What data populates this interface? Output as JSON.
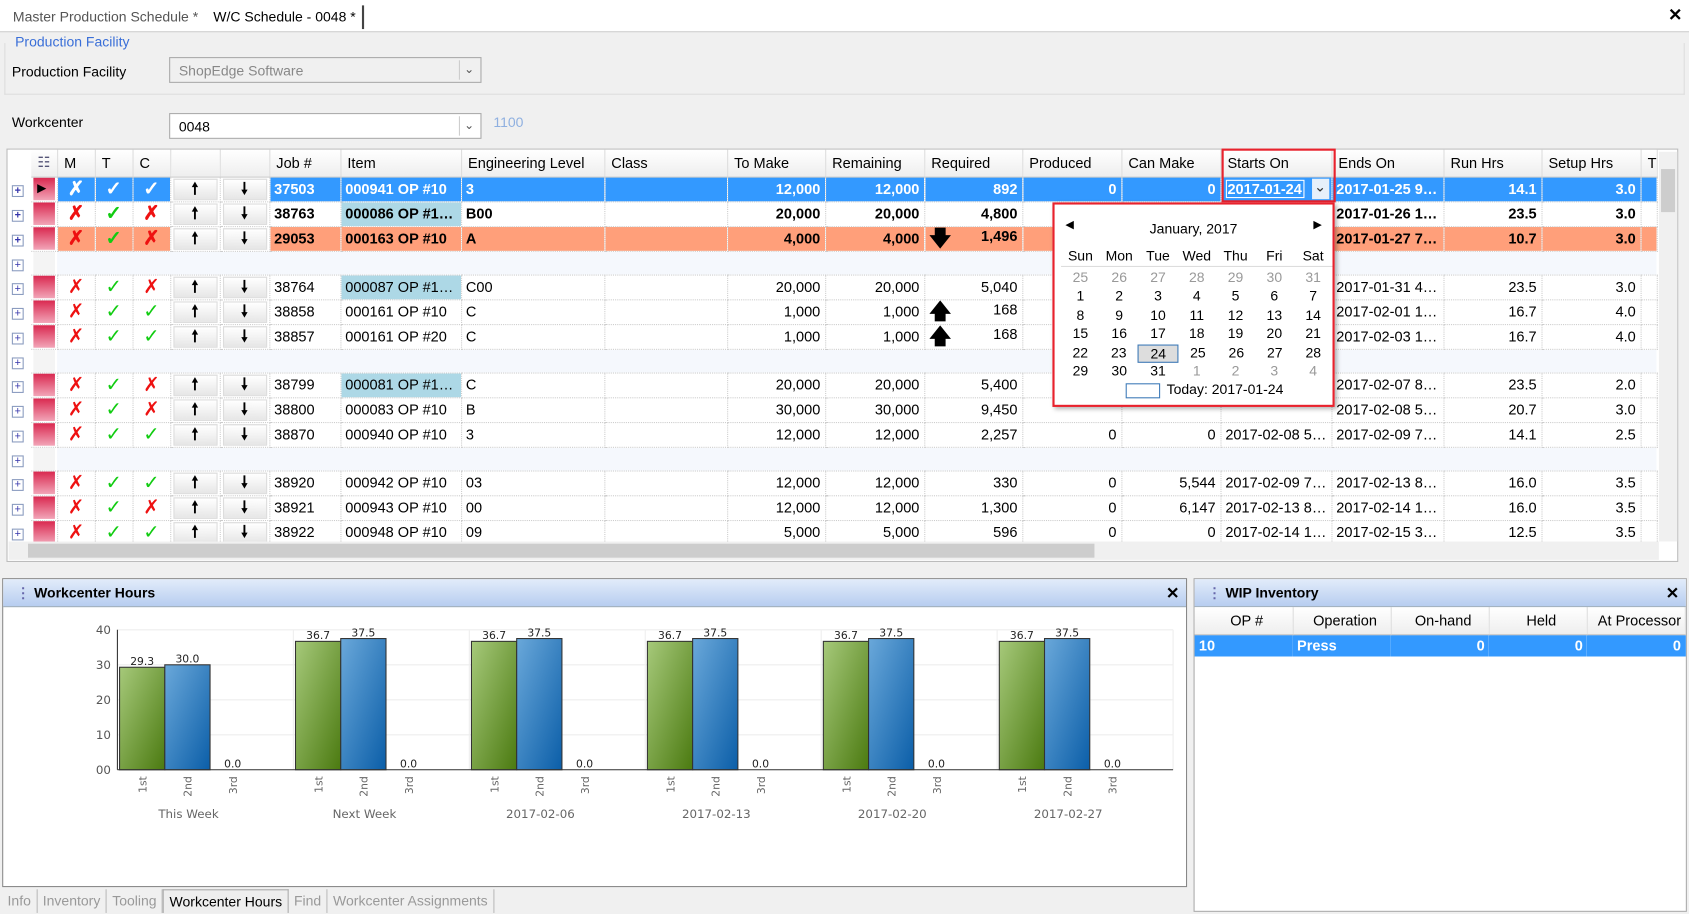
{
  "window": {
    "tabs": [
      {
        "label": "Master Production Schedule *",
        "active": false
      },
      {
        "label": "W/C Schedule - 0048 *",
        "active": true
      }
    ],
    "close_icon": "close-icon"
  },
  "filters": {
    "group_label": "Production Facility",
    "facility_label": "Production Facility",
    "facility_value": "ShopEdge Software",
    "workcenter_label": "Workcenter",
    "workcenter_value": "0048",
    "workcenter_code": "1100"
  },
  "grid": {
    "columns": [
      "M",
      "T",
      "C",
      "",
      "",
      "Job #",
      "Item",
      "Engineering Level",
      "Class",
      "To Make",
      "Remaining",
      "Required",
      "Produced",
      "Can Make",
      "Starts On",
      "Ends On",
      "Run Hrs",
      "Setup Hrs",
      "T"
    ],
    "rows": [
      {
        "style": "sel",
        "m": false,
        "t": true,
        "c": true,
        "job": "37503",
        "item": "000941 OP #10",
        "item_hl": false,
        "eng": "3",
        "class": "",
        "to_make": "12,000",
        "remaining": "12,000",
        "req_arrow": "",
        "required": "892",
        "produced": "0",
        "can_make": "0",
        "starts": "2017-01-24",
        "ends": "2017-01-25 9:...",
        "run": "14.1",
        "setup": "3.0"
      },
      {
        "style": "bold",
        "m": false,
        "t": true,
        "c": false,
        "job": "38763",
        "item": "000086 OP #10...",
        "item_hl": true,
        "eng": "B00",
        "class": "",
        "to_make": "20,000",
        "remaining": "20,000",
        "req_arrow": "",
        "required": "4,800",
        "produced": "",
        "can_make": "",
        "starts": "",
        "ends": "2017-01-26 10...",
        "run": "23.5",
        "setup": "3.0"
      },
      {
        "style": "orange",
        "m": false,
        "t": true,
        "c": false,
        "job": "29053",
        "item": "000163 OP #10",
        "item_hl": false,
        "eng": "A",
        "class": "",
        "to_make": "4,000",
        "remaining": "4,000",
        "req_arrow": "down",
        "required": "1,496",
        "produced": "",
        "can_make": "",
        "starts": "",
        "ends": "2017-01-27 7:...",
        "run": "10.7",
        "setup": "3.0"
      },
      {
        "style": "blank"
      },
      {
        "style": "",
        "m": false,
        "t": true,
        "c": false,
        "job": "38764",
        "item": "000087 OP #10...",
        "item_hl": true,
        "eng": "C00",
        "class": "",
        "to_make": "20,000",
        "remaining": "20,000",
        "req_arrow": "",
        "required": "5,040",
        "produced": "",
        "can_make": "",
        "starts": "",
        "ends": "2017-01-31 4:0...",
        "run": "23.5",
        "setup": "3.0"
      },
      {
        "style": "",
        "m": false,
        "t": true,
        "c": true,
        "job": "38858",
        "item": "000161 OP #10",
        "item_hl": false,
        "eng": "C",
        "class": "",
        "to_make": "1,000",
        "remaining": "1,000",
        "req_arrow": "up",
        "required": "168",
        "produced": "",
        "can_make": "",
        "starts": "",
        "ends": "2017-02-01 10:...",
        "run": "16.7",
        "setup": "4.0"
      },
      {
        "style": "",
        "m": false,
        "t": true,
        "c": true,
        "job": "38857",
        "item": "000161 OP #20",
        "item_hl": false,
        "eng": "C",
        "class": "",
        "to_make": "1,000",
        "remaining": "1,000",
        "req_arrow": "up",
        "required": "168",
        "produced": "",
        "can_make": "",
        "starts": "",
        "ends": "2017-02-03 12:...",
        "run": "16.7",
        "setup": "4.0"
      },
      {
        "style": "blank"
      },
      {
        "style": "",
        "m": false,
        "t": true,
        "c": false,
        "job": "38799",
        "item": "000081 OP #10...",
        "item_hl": true,
        "eng": "C",
        "class": "",
        "to_make": "20,000",
        "remaining": "20,000",
        "req_arrow": "",
        "required": "5,400",
        "produced": "",
        "can_make": "",
        "starts": "",
        "ends": "2017-02-07 8:0...",
        "run": "23.5",
        "setup": "2.0"
      },
      {
        "style": "",
        "m": false,
        "t": true,
        "c": false,
        "job": "38800",
        "item": "000083 OP #10",
        "item_hl": false,
        "eng": "B",
        "class": "",
        "to_make": "30,000",
        "remaining": "30,000",
        "req_arrow": "",
        "required": "9,450",
        "produced": "",
        "can_make": "",
        "starts": "",
        "ends": "2017-02-08 5:3...",
        "run": "20.7",
        "setup": "3.0"
      },
      {
        "style": "",
        "m": false,
        "t": true,
        "c": true,
        "job": "38870",
        "item": "000940 OP #10",
        "item_hl": false,
        "eng": "3",
        "class": "",
        "to_make": "12,000",
        "remaining": "12,000",
        "req_arrow": "",
        "required": "2,257",
        "produced": "0",
        "can_make": "0",
        "starts": "2017-02-08 5:3...",
        "ends": "2017-02-09 7:4...",
        "run": "14.1",
        "setup": "2.5"
      },
      {
        "style": "blank"
      },
      {
        "style": "",
        "m": false,
        "t": true,
        "c": true,
        "job": "38920",
        "item": "000942 OP #10",
        "item_hl": false,
        "eng": "03",
        "class": "",
        "to_make": "12,000",
        "remaining": "12,000",
        "req_arrow": "",
        "required": "330",
        "produced": "0",
        "can_make": "5,544",
        "starts": "2017-02-09 7:4...",
        "ends": "2017-02-13 8:3...",
        "run": "16.0",
        "setup": "3.5"
      },
      {
        "style": "",
        "m": false,
        "t": true,
        "c": false,
        "job": "38921",
        "item": "000943 OP #10",
        "item_hl": false,
        "eng": "00",
        "class": "",
        "to_make": "12,000",
        "remaining": "12,000",
        "req_arrow": "",
        "required": "1,300",
        "produced": "0",
        "can_make": "6,147",
        "starts": "2017-02-13 8:3...",
        "ends": "2017-02-14 1:5...",
        "run": "16.0",
        "setup": "3.5"
      },
      {
        "style": "",
        "m": false,
        "t": true,
        "c": true,
        "job": "38922",
        "item": "000948 OP #10",
        "item_hl": false,
        "eng": "09",
        "class": "",
        "to_make": "5,000",
        "remaining": "5,000",
        "req_arrow": "",
        "required": "596",
        "produced": "0",
        "can_make": "0",
        "starts": "2017-02-14 1:5...",
        "ends": "2017-02-15 3:0...",
        "run": "12.5",
        "setup": "3.5"
      }
    ]
  },
  "calendar": {
    "title": "January, 2017",
    "weekdays": [
      "Sun",
      "Mon",
      "Tue",
      "Wed",
      "Thu",
      "Fri",
      "Sat"
    ],
    "weeks": [
      [
        25,
        26,
        27,
        28,
        29,
        30,
        31
      ],
      [
        1,
        2,
        3,
        4,
        5,
        6,
        7
      ],
      [
        8,
        9,
        10,
        11,
        12,
        13,
        14
      ],
      [
        15,
        16,
        17,
        18,
        19,
        20,
        21
      ],
      [
        22,
        23,
        24,
        25,
        26,
        27,
        28
      ],
      [
        29,
        30,
        31,
        1,
        2,
        3,
        4
      ]
    ],
    "selected": 24,
    "today_label": "Today: 2017-01-24"
  },
  "workcenter_hours": {
    "title": "Workcenter Hours"
  },
  "chart_data": {
    "type": "bar",
    "ylim": [
      0,
      40
    ],
    "yticks": [
      "00",
      "10",
      "20",
      "30",
      "40"
    ],
    "groups": [
      "This Week",
      "Next Week",
      "2017-02-06",
      "2017-02-13",
      "2017-02-20",
      "2017-02-27"
    ],
    "categories": [
      "1st",
      "2nd",
      "3rd"
    ],
    "values": [
      [
        29.3,
        30.0,
        0.0
      ],
      [
        36.7,
        37.5,
        0.0
      ],
      [
        36.7,
        37.5,
        0.0
      ],
      [
        36.7,
        37.5,
        0.0
      ],
      [
        36.7,
        37.5,
        0.0
      ],
      [
        36.7,
        37.5,
        0.0
      ]
    ],
    "colors": [
      "#6a9a2a",
      "#2a78b8"
    ],
    "grid": true
  },
  "bottom_tabs": [
    {
      "label": "Info",
      "active": false
    },
    {
      "label": "Inventory",
      "active": false
    },
    {
      "label": "Tooling",
      "active": false
    },
    {
      "label": "Workcenter Hours",
      "active": true
    },
    {
      "label": "Find",
      "active": false
    },
    {
      "label": "Workcenter Assignments",
      "active": false
    }
  ],
  "wip": {
    "title": "WIP Inventory",
    "columns": [
      "OP #",
      "Operation",
      "On-hand",
      "Held",
      "At Processor"
    ],
    "rows": [
      [
        "10",
        "Press",
        "0",
        "0",
        "0"
      ]
    ]
  }
}
